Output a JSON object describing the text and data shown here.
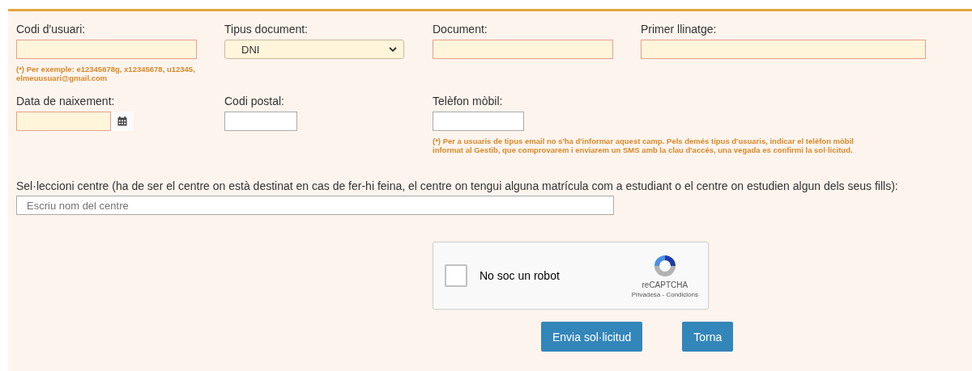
{
  "rows": [
    [
      {
        "kind": "text",
        "label": "Codi d'usuari:",
        "required": true,
        "hint": "(*) Per exemple: e12345678g, x12345678, u12345, elmeuusuari@gmail.com"
      },
      {
        "kind": "select",
        "label": "Tipus document:",
        "required": true,
        "value": "DNI"
      },
      {
        "kind": "text",
        "label": "Document:",
        "required": true
      },
      {
        "kind": "text",
        "label": "Primer llinatge:",
        "required": true
      }
    ],
    [
      {
        "kind": "date",
        "label": "Data de naixement:",
        "required": true
      },
      {
        "kind": "text",
        "label": "Codi postal:",
        "required": false
      },
      {
        "kind": "text",
        "label": "Telèfon mòbil:",
        "required": false,
        "hint": "(*) Per a usuaris de tipus email no s'ha d'informar aquest camp. Pels demés tipus d'usuaris, indicar el telèfon mòbil informat al Gestib, que comprovarem i enviarem un SMS amb la clau d'accés, una vegada es confirmi la sol·licitud."
      }
    ]
  ],
  "centre": {
    "label": "Sel·leccioni centre (ha de ser el centre on està destinat en cas de fer-hi feina, el centre on tengui alguna matrícula com a estudiant o el centre on estudien algun dels seus fills):",
    "placeholder": "Escriu nom del centre"
  },
  "captcha": {
    "label": "No soc un robot",
    "checked": false,
    "brand": "reCAPTCHA",
    "privacy": "Privadesa",
    "separator": "-",
    "terms": "Condicions"
  },
  "buttons": [
    "Envia sol·licitud",
    "Torna"
  ]
}
